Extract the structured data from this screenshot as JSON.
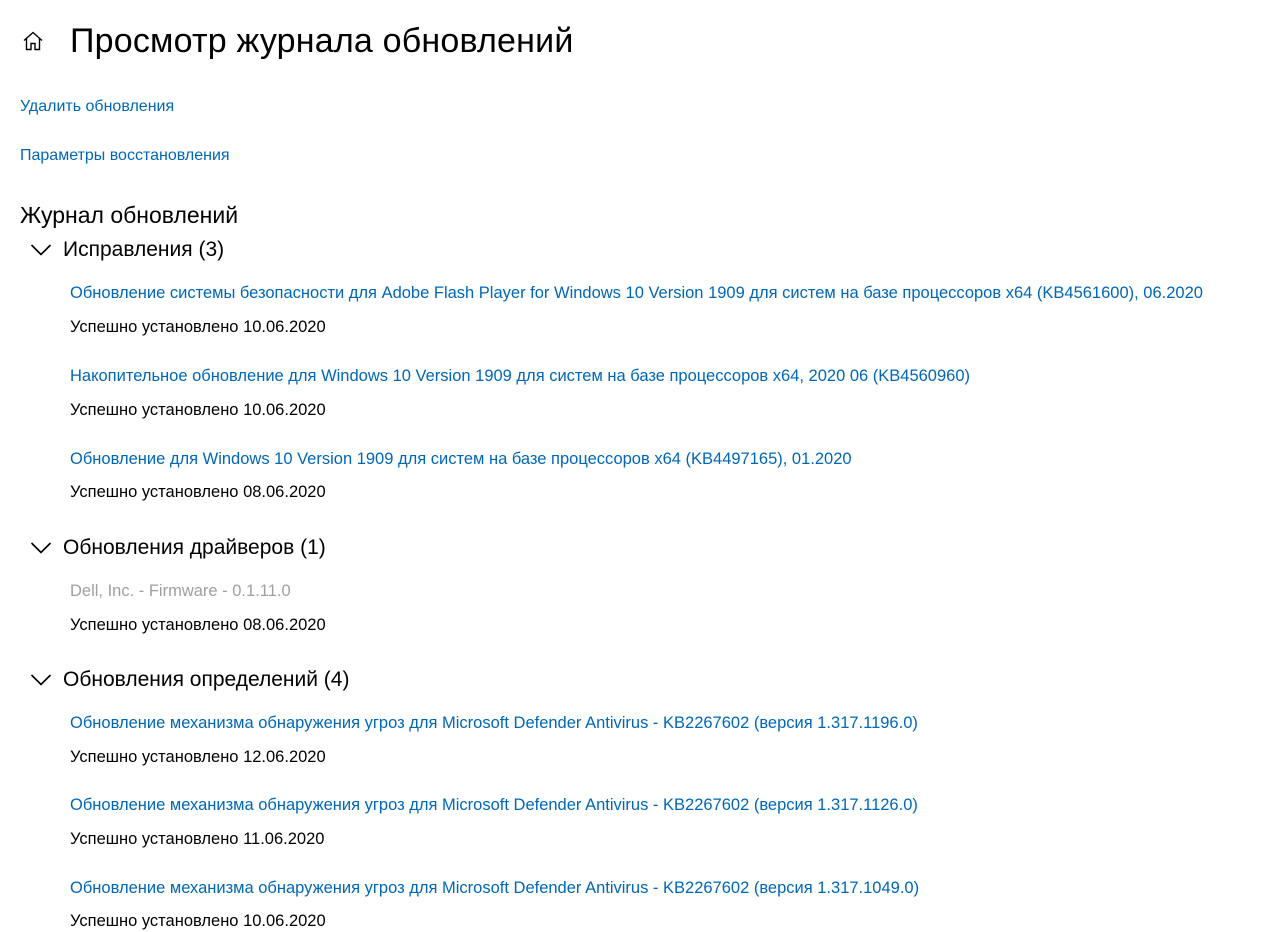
{
  "header": {
    "title": "Просмотр журнала обновлений",
    "home_icon": "home-icon"
  },
  "links": {
    "uninstall": "Удалить обновления",
    "recovery": "Параметры восстановления"
  },
  "history_title": "Журнал обновлений",
  "groups": [
    {
      "label": "Исправления (3)",
      "expanded": true,
      "items": [
        {
          "title": "Обновление системы безопасности для Adobe Flash Player for Windows 10 Version 1909 для систем на базе процессоров x64 (KB4561600), 06.2020",
          "status": "Успешно установлено 10.06.2020"
        },
        {
          "title": "Накопительное обновление для Windows 10 Version 1909 для систем на базе процессоров x64, 2020 06 (KB4560960)",
          "status": "Успешно установлено 10.06.2020"
        },
        {
          "title": "Обновление для Windows 10 Version 1909 для систем на базе процессоров x64 (KB4497165), 01.2020",
          "status": "Успешно установлено 08.06.2020"
        }
      ]
    },
    {
      "label": "Обновления драйверов (1)",
      "expanded": true,
      "items": [
        {
          "title": "Dell, Inc. - Firmware - 0.1.11.0",
          "status": "Успешно установлено 08.06.2020",
          "disabled": true
        }
      ]
    },
    {
      "label": "Обновления определений (4)",
      "expanded": true,
      "items": [
        {
          "title": "Обновление механизма обнаружения угроз для Microsoft Defender Antivirus - KB2267602 (версия 1.317.1196.0)",
          "status": "Успешно установлено 12.06.2020"
        },
        {
          "title": "Обновление механизма обнаружения угроз для Microsoft Defender Antivirus - KB2267602 (версия 1.317.1126.0)",
          "status": "Успешно установлено 11.06.2020"
        },
        {
          "title": "Обновление механизма обнаружения угроз для Microsoft Defender Antivirus - KB2267602 (версия 1.317.1049.0)",
          "status": "Успешно установлено 10.06.2020"
        }
      ]
    }
  ],
  "colors": {
    "link": "#0067b8",
    "disabled": "#a0a0a0",
    "text": "#000000",
    "background": "#ffffff"
  }
}
